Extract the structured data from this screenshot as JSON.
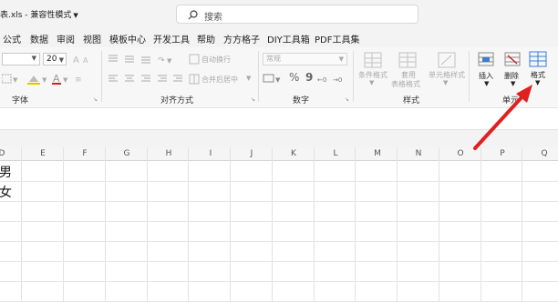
{
  "titlebar": {
    "doc_title": "表.xls - 兼容性模式",
    "search_placeholder": "搜索"
  },
  "menu": {
    "tabs": [
      "公式",
      "数据",
      "审阅",
      "视图",
      "模板中心",
      "开发工具",
      "帮助",
      "方方格子",
      "DIY工具箱",
      "PDF工具集"
    ]
  },
  "ribbon": {
    "font_size": "20",
    "font_group_label": "字体",
    "alignment": {
      "wrap_text": "自动换行",
      "merge_center": "合并后居中",
      "group_label": "对齐方式"
    },
    "number": {
      "format_value": "常规",
      "percent": "%",
      "comma": "9",
      "group_label": "数字"
    },
    "styles": {
      "conditional_format": "条件格式",
      "table_format_line1": "套用",
      "table_format_line2": "表格格式",
      "cell_styles": "单元格样式",
      "group_label": "样式"
    },
    "cells": {
      "insert": "插入",
      "delete": "删除",
      "format": "格式",
      "group_label": "单元"
    }
  },
  "sheet": {
    "columns": [
      "D",
      "E",
      "F",
      "G",
      "H",
      "I",
      "J",
      "K",
      "L",
      "M",
      "N",
      "O",
      "P",
      "Q"
    ],
    "column_d_values": [
      "男",
      "女"
    ]
  },
  "annotation": {
    "arrow_color": "#e02020"
  }
}
